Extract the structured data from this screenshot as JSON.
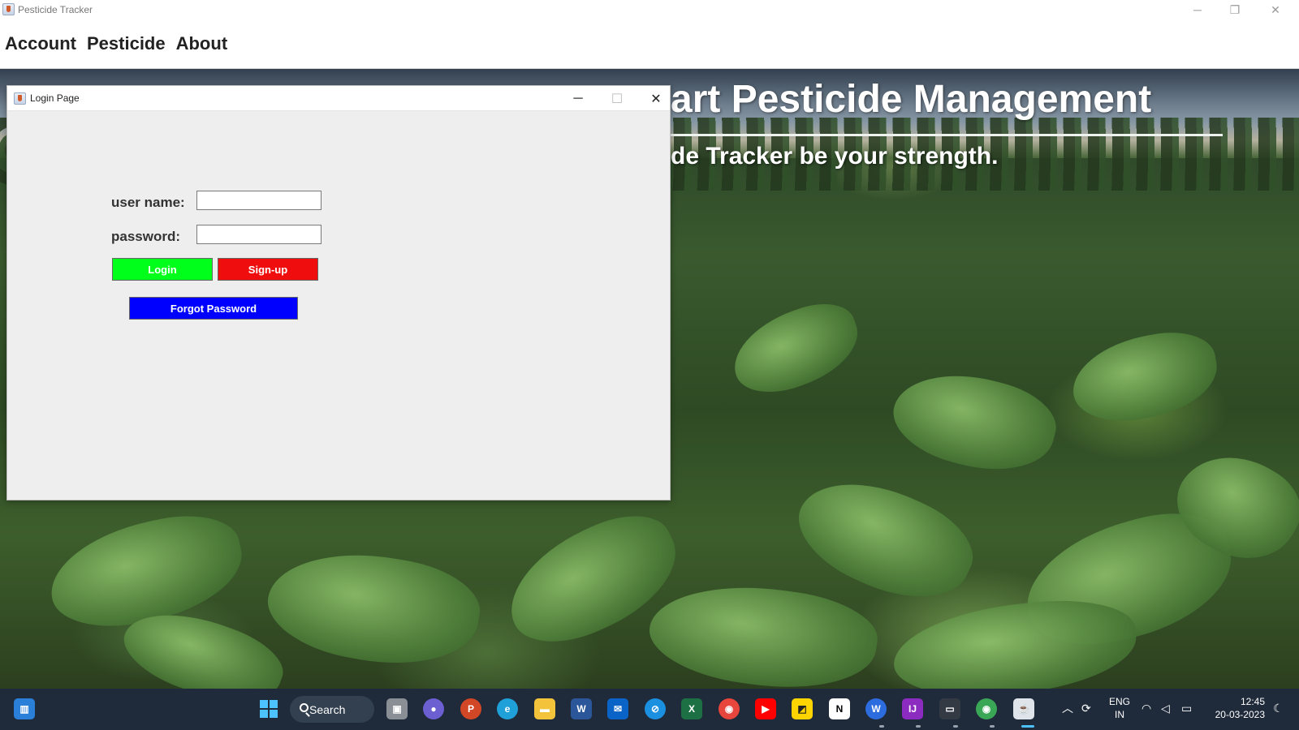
{
  "main_window": {
    "title": "Pesticide Tracker",
    "controls": {
      "minimize": "─",
      "restore": "❐",
      "close": "✕"
    }
  },
  "menu": {
    "items": [
      {
        "label": "Account"
      },
      {
        "label": "Pesticide"
      },
      {
        "label": "About"
      }
    ]
  },
  "hero": {
    "title": "art Pesticide Management",
    "subtitle": "de Tracker be your strength."
  },
  "login_dialog": {
    "title": "Login Page",
    "controls": {
      "minimize": "─",
      "maximize": "☐",
      "close": "✕"
    },
    "username_label": "user name:",
    "username_value": "",
    "password_label": "password:",
    "password_value": "",
    "login_button": {
      "label": "Login",
      "color": "#00ff1a"
    },
    "signup_button": {
      "label": "Sign-up",
      "color": "#f00d0d"
    },
    "forgot_button": {
      "label": "Forgot Password",
      "color": "#0000ff"
    }
  },
  "taskbar": {
    "search_label": "Search",
    "language": {
      "line1": "ENG",
      "line2": "IN"
    },
    "time": "12:45",
    "date": "20-03-2023",
    "pinned_icons": [
      "widgets-icon",
      "windows-start-icon",
      "search-icon",
      "task-view-icon",
      "teams-chat-icon",
      "powerpoint-icon",
      "edge-icon",
      "file-explorer-icon",
      "word-icon",
      "mail-icon",
      "safari-icon",
      "excel-icon",
      "chrome-icon",
      "youtube-icon",
      "sticky-notes-icon",
      "notion-icon",
      "wondershare-icon",
      "intellij-icon",
      "terminal-icon",
      "chrome-profile-icon",
      "java-app-icon"
    ],
    "tray_icons": [
      "chevron-up-icon",
      "sync-icon",
      "wifi-icon",
      "speaker-icon",
      "battery-icon",
      "notification-icon"
    ]
  }
}
